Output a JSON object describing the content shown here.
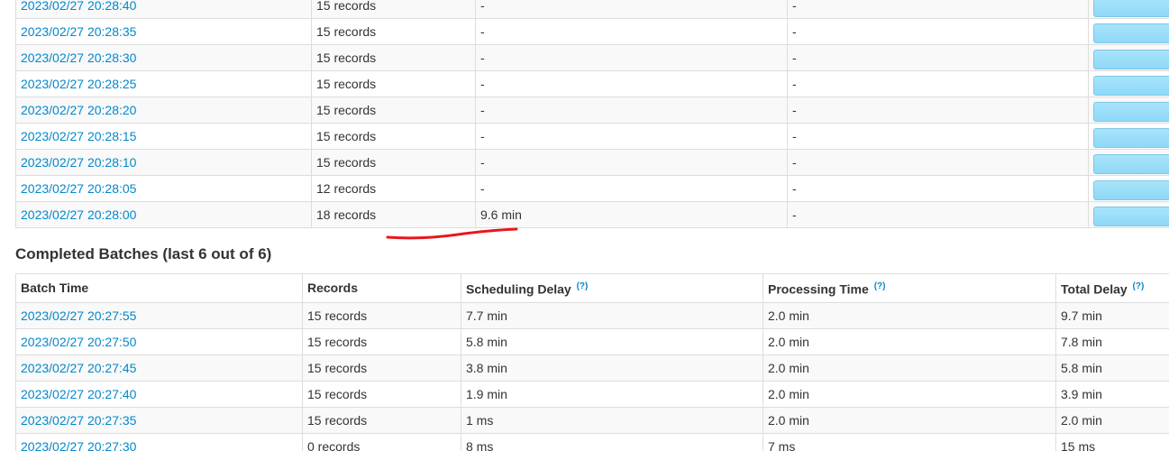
{
  "running_batches": {
    "rows": [
      {
        "batch_time": "2023/02/27 20:28:40",
        "records": "15 records",
        "scheduling_delay": "-",
        "processing_time": "-"
      },
      {
        "batch_time": "2023/02/27 20:28:35",
        "records": "15 records",
        "scheduling_delay": "-",
        "processing_time": "-"
      },
      {
        "batch_time": "2023/02/27 20:28:30",
        "records": "15 records",
        "scheduling_delay": "-",
        "processing_time": "-"
      },
      {
        "batch_time": "2023/02/27 20:28:25",
        "records": "15 records",
        "scheduling_delay": "-",
        "processing_time": "-"
      },
      {
        "batch_time": "2023/02/27 20:28:20",
        "records": "15 records",
        "scheduling_delay": "-",
        "processing_time": "-"
      },
      {
        "batch_time": "2023/02/27 20:28:15",
        "records": "15 records",
        "scheduling_delay": "-",
        "processing_time": "-"
      },
      {
        "batch_time": "2023/02/27 20:28:10",
        "records": "15 records",
        "scheduling_delay": "-",
        "processing_time": "-"
      },
      {
        "batch_time": "2023/02/27 20:28:05",
        "records": "12 records",
        "scheduling_delay": "-",
        "processing_time": "-"
      },
      {
        "batch_time": "2023/02/27 20:28:00",
        "records": "18 records",
        "scheduling_delay": "9.6 min",
        "processing_time": "-"
      }
    ]
  },
  "completed_batches": {
    "title": "Completed Batches (last 6 out of 6)",
    "headers": {
      "batch_time": "Batch Time",
      "records": "Records",
      "scheduling_delay": "Scheduling Delay",
      "processing_time": "Processing Time",
      "total_delay": "Total Delay",
      "help": "(?)"
    },
    "rows": [
      {
        "batch_time": "2023/02/27 20:27:55",
        "records": "15 records",
        "scheduling_delay": "7.7 min",
        "processing_time": "2.0 min",
        "total_delay": "9.7 min"
      },
      {
        "batch_time": "2023/02/27 20:27:50",
        "records": "15 records",
        "scheduling_delay": "5.8 min",
        "processing_time": "2.0 min",
        "total_delay": "7.8 min"
      },
      {
        "batch_time": "2023/02/27 20:27:45",
        "records": "15 records",
        "scheduling_delay": "3.8 min",
        "processing_time": "2.0 min",
        "total_delay": "5.8 min"
      },
      {
        "batch_time": "2023/02/27 20:27:40",
        "records": "15 records",
        "scheduling_delay": "1.9 min",
        "processing_time": "2.0 min",
        "total_delay": "3.9 min"
      },
      {
        "batch_time": "2023/02/27 20:27:35",
        "records": "15 records",
        "scheduling_delay": "1 ms",
        "processing_time": "2.0 min",
        "total_delay": "2.0 min"
      },
      {
        "batch_time": "2023/02/27 20:27:30",
        "records": "0 records",
        "scheduling_delay": "8 ms",
        "processing_time": "7 ms",
        "total_delay": "15 ms"
      }
    ]
  },
  "colors": {
    "link": "#0088cc",
    "progress_fill": "#a8e4fb",
    "annotation_stroke": "#e8171c"
  }
}
